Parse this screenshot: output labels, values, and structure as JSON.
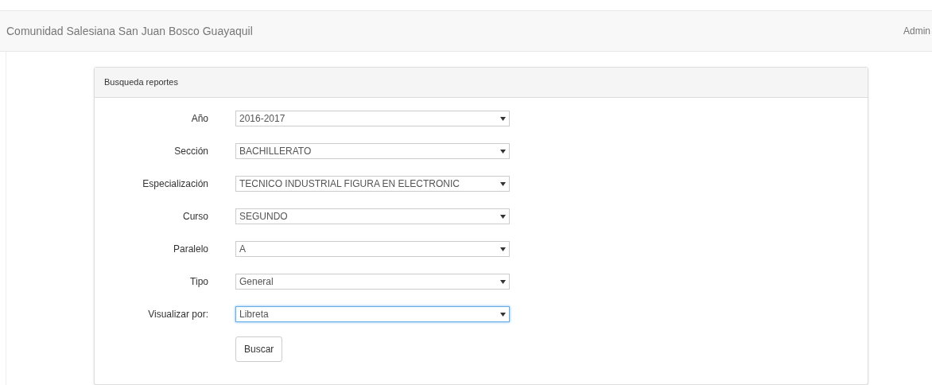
{
  "navbar": {
    "brand": "Comunidad Salesiana San Juan Bosco Guayaquil",
    "user": "Admin"
  },
  "panel": {
    "title": "Busqueda reportes",
    "fields": [
      {
        "label": "Año",
        "value": "2016-2017",
        "focused": false
      },
      {
        "label": "Sección",
        "value": "BACHILLERATO",
        "focused": false
      },
      {
        "label": "Especialización",
        "value": "TECNICO INDUSTRIAL FIGURA EN ELECTRONIC",
        "focused": false
      },
      {
        "label": "Curso",
        "value": "SEGUNDO",
        "focused": false
      },
      {
        "label": "Paralelo",
        "value": "A",
        "focused": false
      },
      {
        "label": "Tipo",
        "value": "General",
        "focused": false
      },
      {
        "label": "Visualizar por:",
        "value": "Libreta",
        "focused": true
      }
    ],
    "button": "Buscar"
  }
}
